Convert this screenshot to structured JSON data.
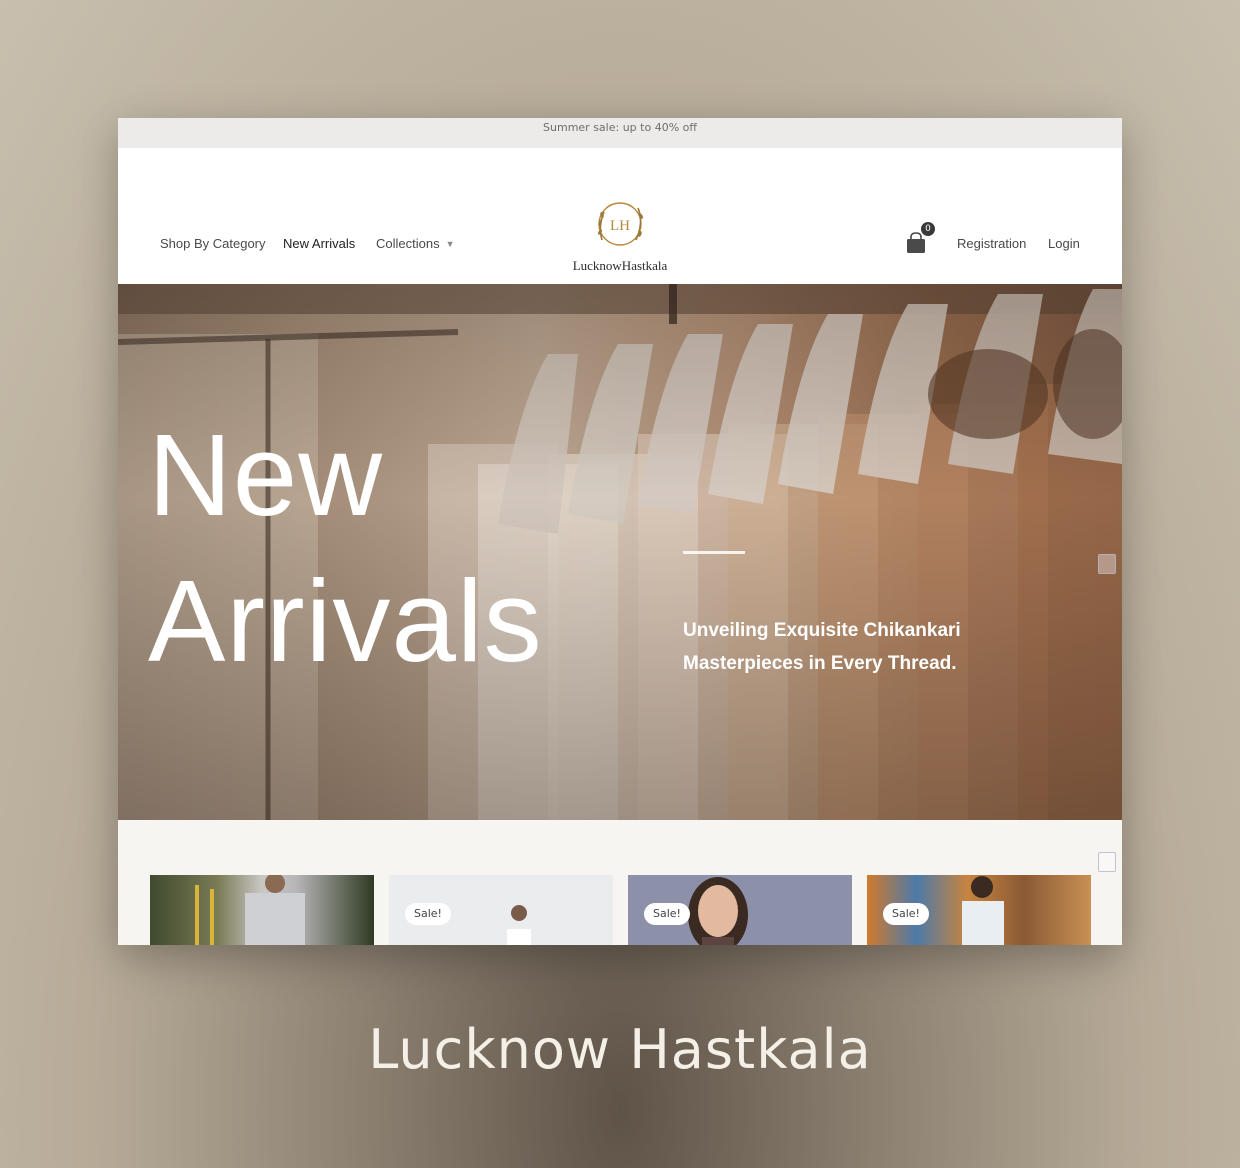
{
  "announcement": "Summer sale: up to 40% off",
  "nav": {
    "shop_by_category": "Shop By Category",
    "new_arrivals": "New Arrivals",
    "collections": "Collections"
  },
  "brand": {
    "monogram": "LH",
    "name": "LucknowHastkala",
    "accent": "#b58a3c"
  },
  "cart": {
    "count": "0"
  },
  "account": {
    "registration": "Registration",
    "login": "Login"
  },
  "hero": {
    "title_line1": "New",
    "title_line2": "Arrivals",
    "subtitle": "Unveiling Exquisite Chikankari Masterpieces in Every Thread."
  },
  "products": [
    {
      "badge": ""
    },
    {
      "badge": "Sale!"
    },
    {
      "badge": "Sale!"
    },
    {
      "badge": "Sale!"
    }
  ],
  "caption": "Lucknow Hastkala"
}
